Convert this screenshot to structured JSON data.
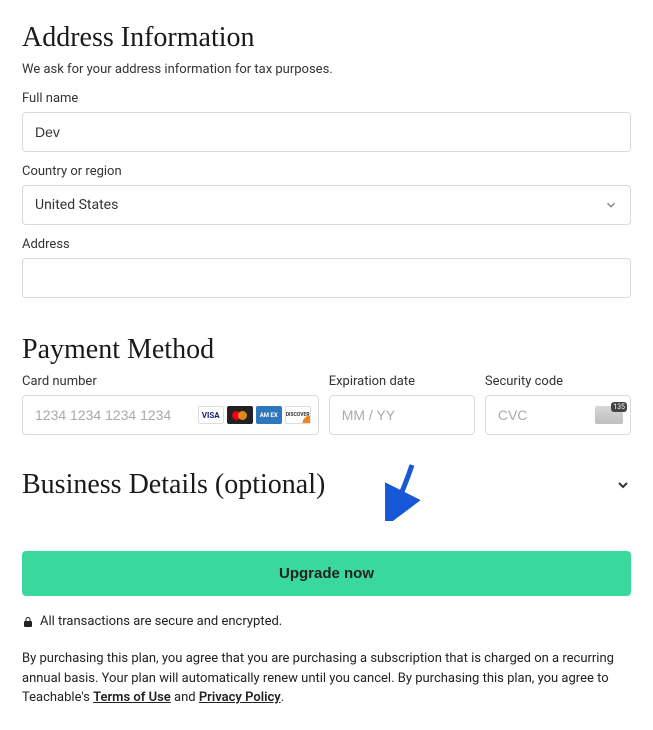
{
  "address": {
    "title": "Address Information",
    "subtitle": "We ask for your address information for tax purposes.",
    "full_name_label": "Full name",
    "full_name_value": "Dev",
    "country_label": "Country or region",
    "country_value": "United States",
    "address_label": "Address",
    "address_value": ""
  },
  "payment": {
    "title": "Payment Method",
    "card_label": "Card number",
    "card_placeholder": "1234 1234 1234 1234",
    "exp_label": "Expiration date",
    "exp_placeholder": "MM / YY",
    "cvc_label": "Security code",
    "cvc_placeholder": "CVC"
  },
  "business": {
    "title": "Business Details (optional)"
  },
  "cta": {
    "label": "Upgrade now"
  },
  "secure": {
    "text": "All transactions are secure and encrypted."
  },
  "legal": {
    "prefix": "By purchasing this plan, you agree that you are purchasing a subscription that is charged on a recurring annual basis. Your plan will automatically renew until you cancel. By purchasing this plan, you agree to Teachable's ",
    "terms": "Terms of Use",
    "and": " and ",
    "privacy": "Privacy Policy",
    "suffix": "."
  }
}
